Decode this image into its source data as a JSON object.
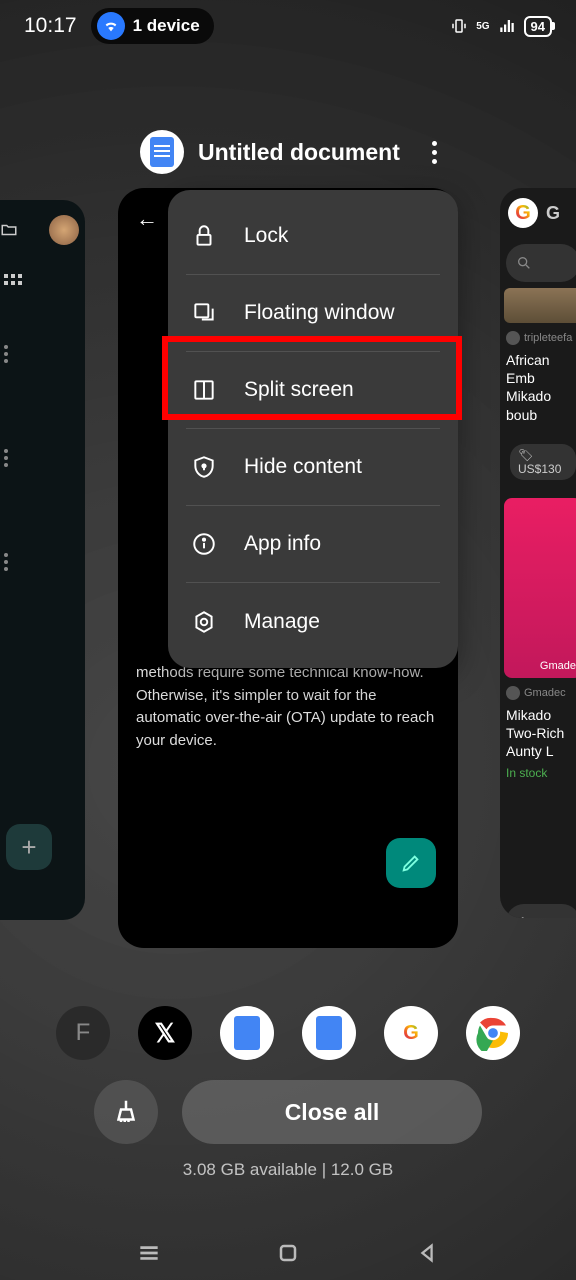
{
  "status_bar": {
    "time": "10:17",
    "device_count": "1 device",
    "network": "5G",
    "battery": "94"
  },
  "current_app": {
    "title": "Untitled document"
  },
  "context_menu": {
    "items": [
      {
        "label": "Lock",
        "icon": "lock"
      },
      {
        "label": "Floating window",
        "icon": "floating"
      },
      {
        "label": "Split screen",
        "icon": "split",
        "highlighted": true
      },
      {
        "label": "Hide content",
        "icon": "shield"
      },
      {
        "label": "App info",
        "icon": "info"
      },
      {
        "label": "Manage",
        "icon": "manage"
      }
    ]
  },
  "card_main": {
    "visible_text": "methods require some technical know-how. Otherwise, it's simpler to wait for the automatic over-the-air (OTA) update to reach your device."
  },
  "right_card": {
    "user1": "tripleteefa",
    "title1": "African Emb Mikado boub",
    "price": "US$130",
    "user2": "Gmadec",
    "title2": "Mikado Two-Rich Aunty L",
    "stock": "In stock",
    "useful_text": "Are these useful?",
    "watermark": "Gmade"
  },
  "dock": {
    "apps": [
      "F",
      "X",
      "Docs",
      "Docs",
      "Google",
      "Chrome"
    ]
  },
  "controls": {
    "close_all": "Close all",
    "memory": "3.08 GB available | 12.0 GB"
  }
}
